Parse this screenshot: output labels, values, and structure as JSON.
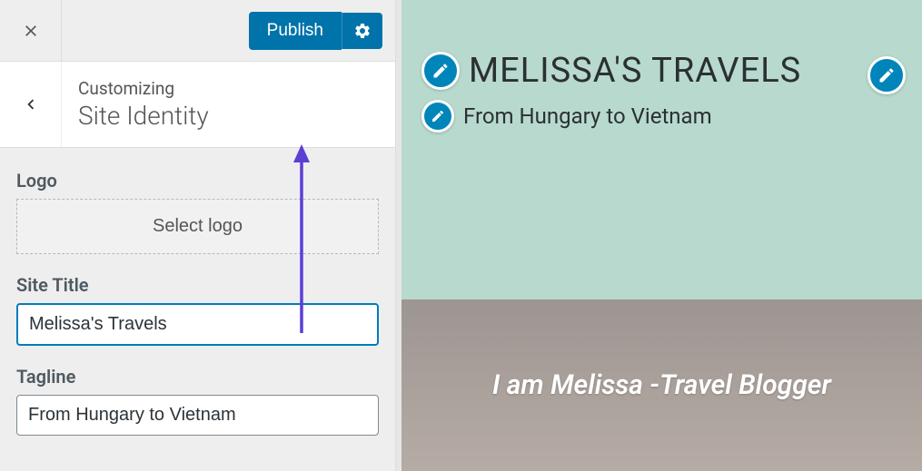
{
  "header": {
    "publish_label": "Publish"
  },
  "section": {
    "customizing_label": "Customizing",
    "name": "Site Identity"
  },
  "controls": {
    "logo_label": "Logo",
    "select_logo_label": "Select logo",
    "site_title_label": "Site Title",
    "site_title_value": "Melissa's Travels",
    "tagline_label": "Tagline",
    "tagline_value": "From Hungary to Vietnam"
  },
  "preview": {
    "site_title": "MELISSA'S TRAVELS",
    "tagline": "From Hungary to Vietnam",
    "hero_headline": "I am Melissa -Travel Blogger"
  }
}
